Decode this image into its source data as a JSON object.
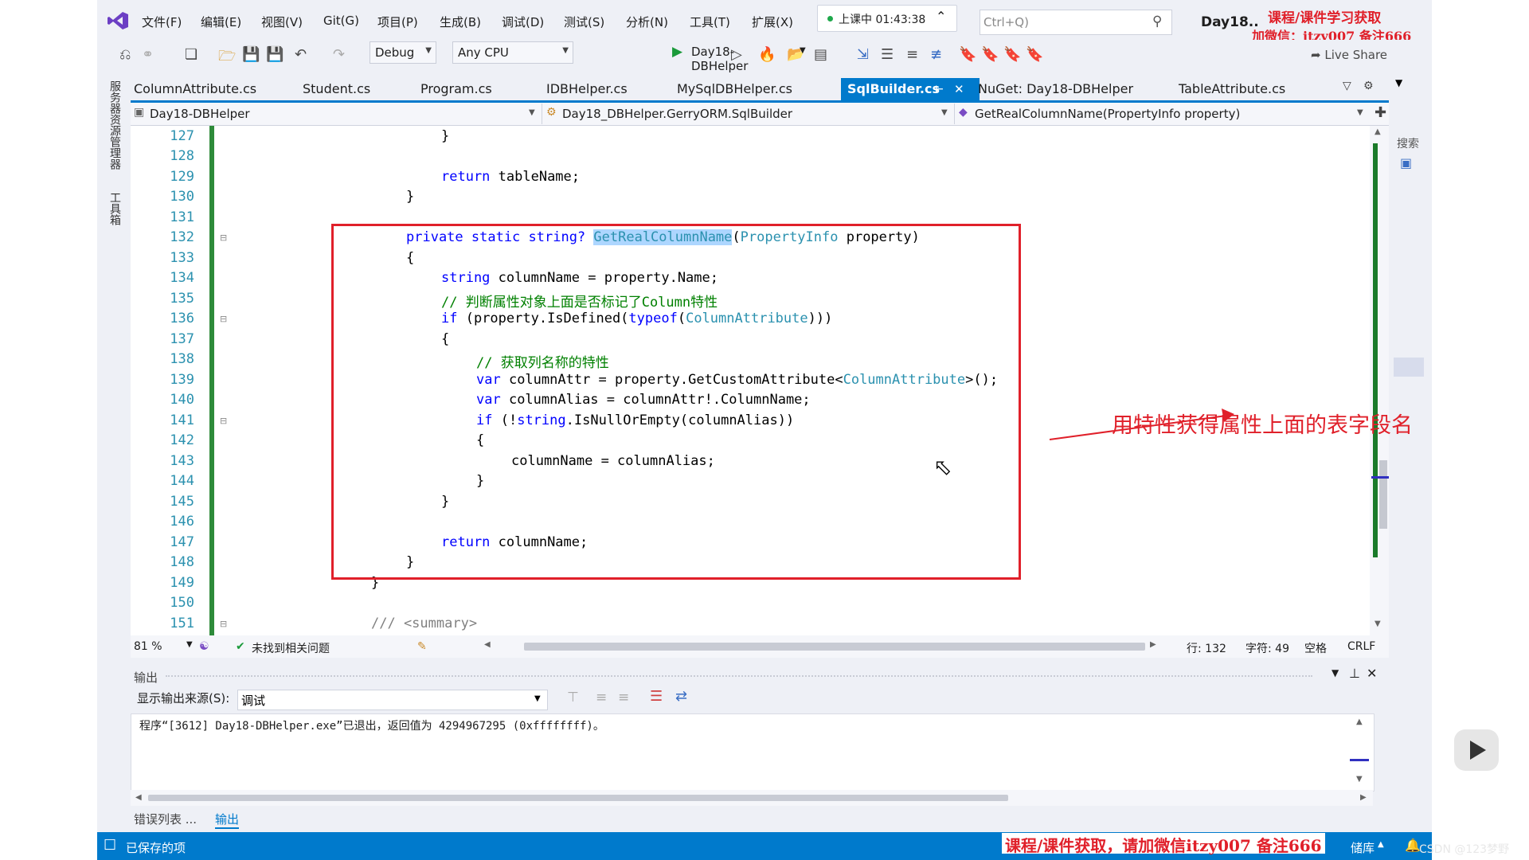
{
  "menu": {
    "items": [
      "文件(F)",
      "编辑(E)",
      "视图(V)",
      "Git(G)",
      "项目(P)",
      "生成(B)",
      "调试(D)",
      "测试(S)",
      "分析(N)",
      "工具(T)",
      "扩展(X)"
    ],
    "timer": "上课中 01:43:38",
    "search_placeholder": "Ctrl+Q)",
    "project_title": "Day18..",
    "watermark_line1": "课程/课件学习获取",
    "watermark_line2": "加微信：itzy007 备注666"
  },
  "toolbar": {
    "config": "Debug",
    "platform": "Any CPU",
    "run_target": "Day18-DBHelper",
    "live_share": "Live Share"
  },
  "side": {
    "left_top": "服务器资源管理器",
    "left_bottom": "工具箱",
    "right_search": "搜索"
  },
  "tabs": [
    {
      "label": "ColumnAttribute.cs",
      "active": false
    },
    {
      "label": "Student.cs",
      "active": false
    },
    {
      "label": "Program.cs",
      "active": false
    },
    {
      "label": "IDBHelper.cs",
      "active": false
    },
    {
      "label": "MySqlDBHelper.cs",
      "active": false
    },
    {
      "label": "SqlBuilder.cs",
      "active": true
    },
    {
      "label": "NuGet: Day18-DBHelper",
      "active": false
    },
    {
      "label": "TableAttribute.cs",
      "active": false
    }
  ],
  "nav": {
    "project": "Day18-DBHelper",
    "class": "Day18_DBHelper.GerryORM.SqlBuilder",
    "member": "GetRealColumnName(PropertyInfo property)"
  },
  "code": {
    "line_numbers": [
      "127",
      "128",
      "129",
      "130",
      "131",
      "132",
      "133",
      "134",
      "135",
      "136",
      "137",
      "138",
      "139",
      "140",
      "141",
      "142",
      "143",
      "144",
      "145",
      "146",
      "147",
      "148",
      "149",
      "150",
      "151"
    ],
    "l127": "}",
    "l129_kw": "return",
    "l129_rest": " tableName;",
    "l130": "}",
    "l132_a": "private static string? ",
    "l132_hl": "GetRealColumnName",
    "l132_b": "(",
    "l132_ty": "PropertyInfo",
    "l132_c": " property)",
    "l133": "{",
    "l134_kw": "string",
    "l134_rest": " columnName = property.Name;",
    "l135": "// 判断属性对象上面是否标记了Column特性",
    "l136_kw": "if",
    "l136_a": " (property.IsDefined(",
    "l136_kw2": "typeof",
    "l136_b": "(",
    "l136_ty": "ColumnAttribute",
    "l136_c": ")))",
    "l137": "{",
    "l138": "// 获取列名称的特性",
    "l139_kw": "var",
    "l139_a": " columnAttr = property.GetCustomAttribute<",
    "l139_ty": "ColumnAttribute",
    "l139_b": ">();",
    "l140_kw": "var",
    "l140_rest": " columnAlias = columnAttr!.ColumnName;",
    "l141_kw": "if",
    "l141_a": " (!",
    "l141_kw2": "string",
    "l141_b": ".IsNullOrEmpty(columnAlias))",
    "l142": "{",
    "l143": "columnName = columnAlias;",
    "l144": "}",
    "l145": "}",
    "l147_kw": "return",
    "l147_rest": " columnName;",
    "l148": "}",
    "l149": "}",
    "l151": "/// <summary>"
  },
  "annotation": "用特性获得属性上面的表字段名",
  "editor_status": {
    "zoom": "81 %",
    "issues": "未找到相关问题",
    "line": "行: 132",
    "char": "字符: 49",
    "space": "空格",
    "eol": "CRLF"
  },
  "output": {
    "title": "输出",
    "source_label": "显示输出来源(S):",
    "source_value": "调试",
    "text": "程序“[3612] Day18-DBHelper.exe”已退出，返回值为 4294967295 (0xffffffff)。"
  },
  "bottom_tabs": [
    "错误列表 ...",
    "输出"
  ],
  "statusbar": {
    "saved": "已保存的项",
    "banner": "课程/课件获取，请加微信itzy007 备注666",
    "right": "储库",
    "csdn": "CSDN @123梦野"
  },
  "colors": {
    "accent": "#007acc",
    "annotation": "#e0202a",
    "keyword": "#0000ff",
    "type": "#2b91af",
    "comment": "#008000"
  }
}
